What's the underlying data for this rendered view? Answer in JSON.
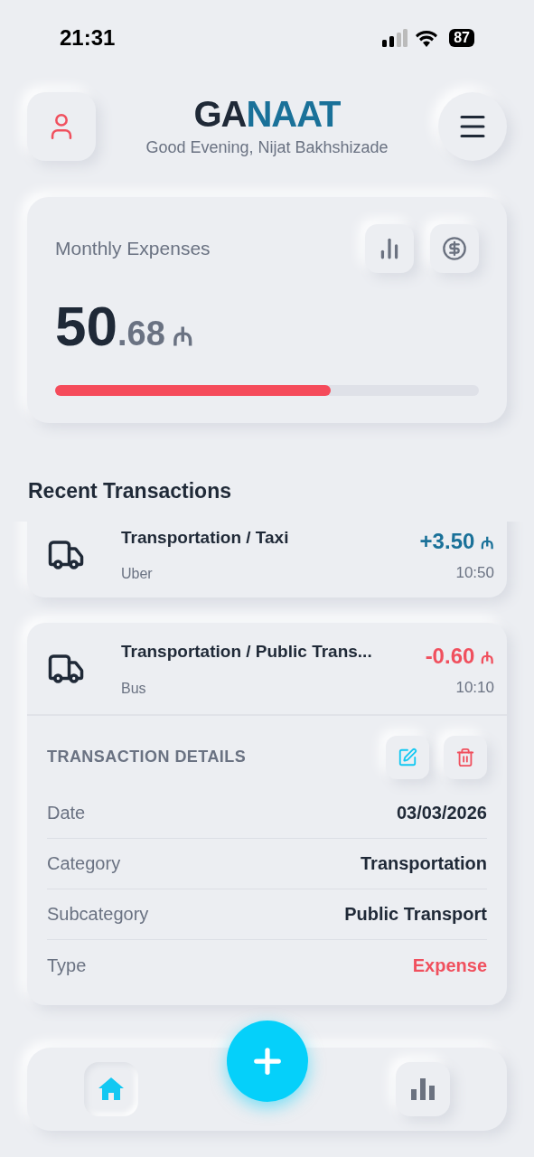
{
  "status_bar": {
    "time": "21:31",
    "battery": "87"
  },
  "header": {
    "logo": {
      "dark": "GA",
      "accent": "NAAT"
    },
    "greeting": "Good Evening, Nijat Bakhshizade"
  },
  "summary": {
    "title": "Monthly Expenses",
    "amount_whole": "50",
    "amount_fraction": ".68",
    "currency": "₼",
    "level": 0.65
  },
  "recent": {
    "title": "Recent Transactions",
    "items": [
      {
        "title": "Transportation / Taxi",
        "subtitle": "Uber",
        "amount": "+3.50",
        "currency": "₼",
        "time": "10:50",
        "kind": "income",
        "expanded": false
      },
      {
        "title": "Transportation / Public Trans...",
        "subtitle": "Bus",
        "amount": "-0.60",
        "currency": "₼",
        "time": "10:10",
        "kind": "expense",
        "expanded": true,
        "details": {
          "title": "TRANSACTION DETAILS",
          "rows": [
            {
              "label": "Date",
              "value": "03/03/2026",
              "kind": "plain"
            },
            {
              "label": "Category",
              "value": "Transportation",
              "kind": "plain"
            },
            {
              "label": "Subcategory",
              "value": "Public Transport",
              "kind": "plain"
            },
            {
              "label": "Type",
              "value": "Expense",
              "kind": "expense"
            }
          ]
        }
      }
    ]
  },
  "nav": {
    "items": [
      {
        "kind": "home",
        "selected": true
      },
      {
        "kind": "stats",
        "selected": false
      }
    ]
  }
}
